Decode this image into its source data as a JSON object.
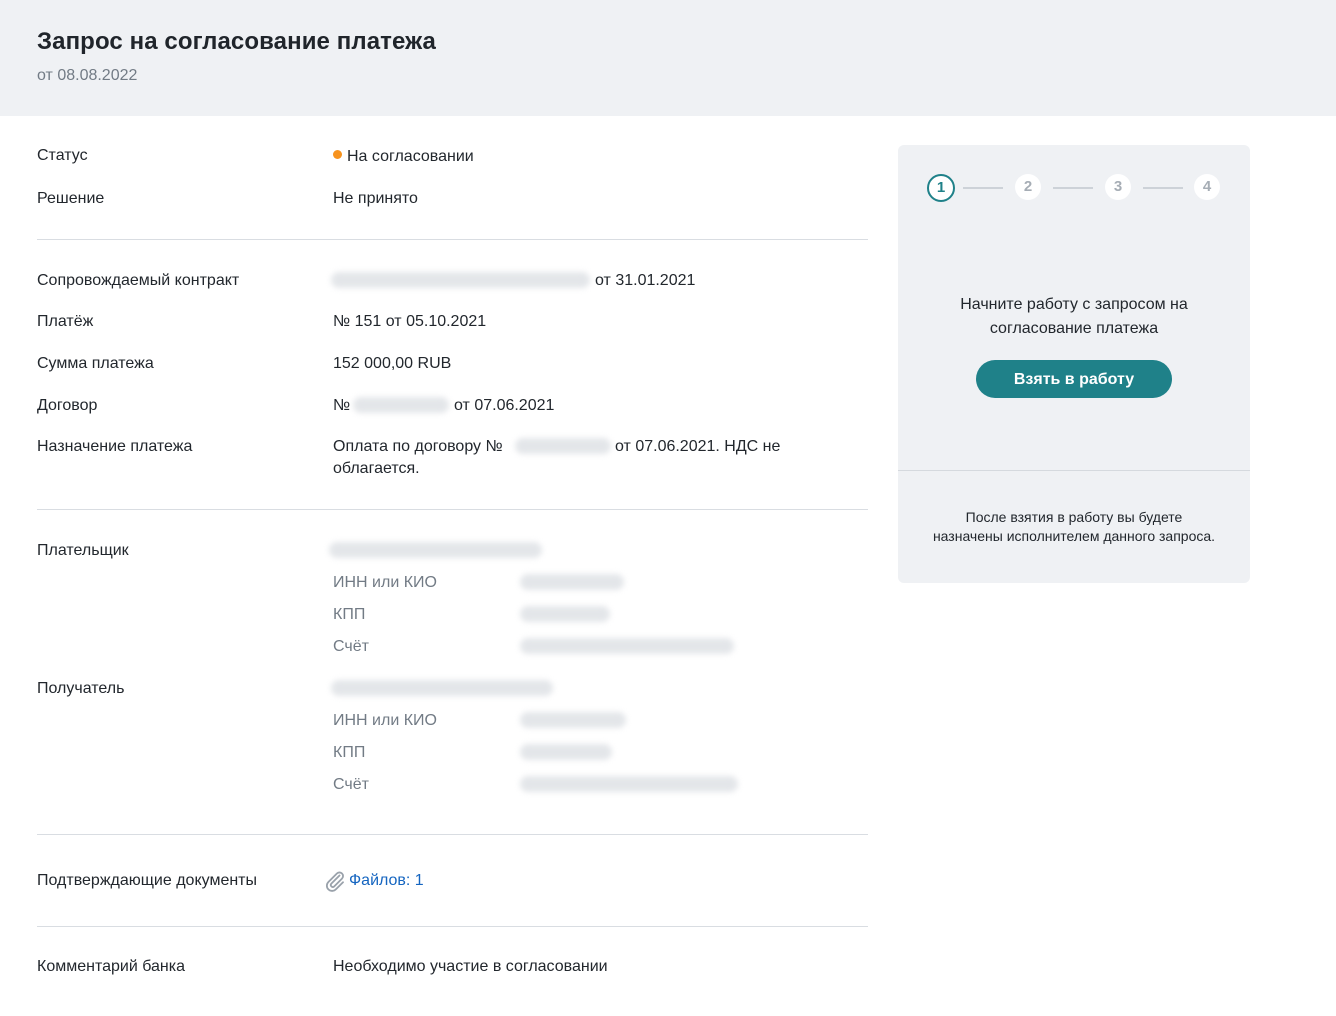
{
  "header": {
    "title": "Запрос на согласование платежа",
    "date": "от 08.08.2022"
  },
  "status": {
    "label": "Статус",
    "value": "На согласовании",
    "dot_color": "#f7931e"
  },
  "decision": {
    "label": "Решение",
    "value": "Не принято"
  },
  "contract": {
    "label": "Сопровождаемый контракт",
    "date_suffix": "от 31.01.2021"
  },
  "payment": {
    "label": "Платёж",
    "value": "№ 151 от 05.10.2021"
  },
  "amount": {
    "label": "Сумма платежа",
    "value": "152 000,00 RUB"
  },
  "agreement": {
    "label": "Договор",
    "prefix": "№",
    "date_suffix": "от 07.06.2021"
  },
  "purpose": {
    "label": "Назначение платежа",
    "prefix": "Оплата по договору №",
    "suffix": "от 07.06.2021. НДС не",
    "line2": "облагается."
  },
  "payer": {
    "label": "Плательщик",
    "fields": {
      "inn": "ИНН или КИО",
      "kpp": "КПП",
      "account": "Счёт"
    }
  },
  "recipient": {
    "label": "Получатель",
    "fields": {
      "inn": "ИНН или КИО",
      "kpp": "КПП",
      "account": "Счёт"
    }
  },
  "documents": {
    "label": "Подтверждающие документы",
    "link": "Файлов: 1",
    "icon": "paperclip-icon"
  },
  "comment": {
    "label": "Комментарий банка",
    "value": "Необходимо участие в согласовании"
  },
  "panel": {
    "steps": [
      "1",
      "2",
      "3",
      "4"
    ],
    "active_step": 1,
    "message_line1": "Начните работу с запросом на",
    "message_line2": "согласование платежа",
    "button": "Взять в работу",
    "note_line1": "После взятия в работу вы будете",
    "note_line2": "назначены исполнителем данного запроса.",
    "accent": "#1f8189"
  }
}
